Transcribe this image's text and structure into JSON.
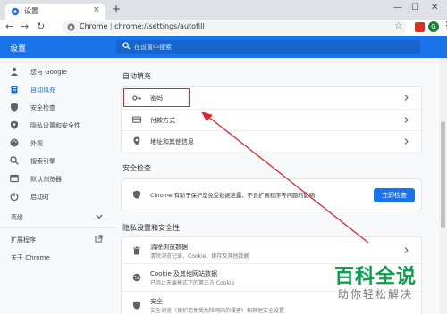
{
  "browser": {
    "tab_title": "设置",
    "tab_close": "×",
    "new_tab": "+",
    "win_min": "—",
    "win_max": "☐",
    "win_close": "✕",
    "nav_back": "←",
    "nav_forward": "→",
    "nav_reload": "↻",
    "url_scheme": "Chrome",
    "url_sep": " | ",
    "url_path": "chrome://settings/autofill",
    "profile_initial": "G",
    "menu": "⋮",
    "star": "☆"
  },
  "header": {
    "title": "设置",
    "search_placeholder": "在设置中搜索"
  },
  "sidebar": {
    "items": [
      {
        "label": "您与 Google",
        "icon": "person-icon"
      },
      {
        "label": "自动填充",
        "icon": "autofill-icon",
        "active": true
      },
      {
        "label": "安全检查",
        "icon": "shield-icon"
      },
      {
        "label": "隐私设置和安全性",
        "icon": "privacy-shield-icon"
      },
      {
        "label": "外观",
        "icon": "palette-icon"
      },
      {
        "label": "搜索引擎",
        "icon": "search-engine-icon"
      },
      {
        "label": "默认浏览器",
        "icon": "browser-icon"
      },
      {
        "label": "启动时",
        "icon": "power-icon"
      }
    ],
    "advanced": "高级",
    "extensions": "扩展程序",
    "about": "关于 Chrome"
  },
  "autofill": {
    "title": "自动填充",
    "rows": [
      {
        "label": "密码",
        "icon": "key-icon"
      },
      {
        "label": "付款方式",
        "icon": "credit-card-icon"
      },
      {
        "label": "地址和其他信息",
        "icon": "location-pin-icon"
      }
    ]
  },
  "safety": {
    "title": "安全检查",
    "text": "Chrome 有助于保护您免受数据泄露、不良扩展程序等问题的影响",
    "button": "立即检查"
  },
  "privacy": {
    "title": "隐私设置和安全性",
    "rows": [
      {
        "label": "清除浏览数据",
        "sub": "清除浏览记录、Cookie、缓存及其他数据"
      },
      {
        "label": "Cookie 及其他网站数据",
        "sub": "已阻止无痕模式下的第三方 Cookie"
      },
      {
        "label": "安全",
        "sub": "安全浏览（保护您免受危险网站的侵害）和其他安全设置"
      }
    ]
  },
  "watermark": {
    "main": "百科全说",
    "sub": "助你轻松解决"
  },
  "colors": {
    "accent": "#1a73e8",
    "highlight": "#e0252c",
    "watermark": "#0aa14b"
  }
}
